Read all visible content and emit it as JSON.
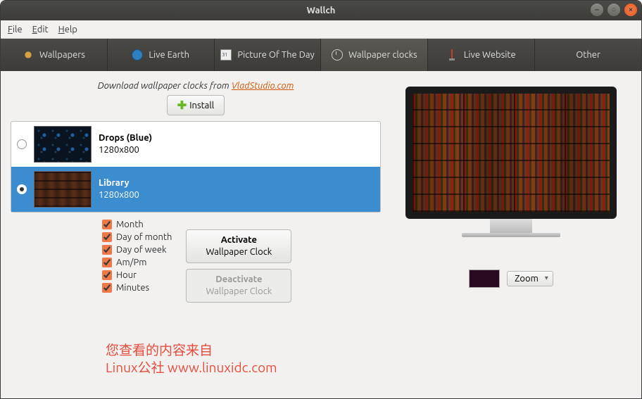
{
  "window": {
    "title": "Wallch"
  },
  "menu": {
    "file": "File",
    "edit": "Edit",
    "help": "Help"
  },
  "tabs": {
    "wallpapers": "Wallpapers",
    "liveearth": "Live Earth",
    "potd": "Picture Of The Day",
    "wallclocks": "Wallpaper clocks",
    "livewebsite": "Live Website",
    "other": "Other"
  },
  "intro": {
    "prefix": "Download wallpaper clocks from ",
    "linktext": "VladStudio.com"
  },
  "install_label": "Install",
  "clocks": [
    {
      "name": "Drops (Blue)",
      "res": "1280x800",
      "selected": false
    },
    {
      "name": "Library",
      "res": "1280x800",
      "selected": true
    }
  ],
  "checks": {
    "month": "Month",
    "dayofmonth": "Day of month",
    "dayofweek": "Day of week",
    "ampm": "Am/Pm",
    "hour": "Hour",
    "minutes": "Minutes"
  },
  "buttons": {
    "activate_l1": "Activate",
    "activate_l2": "Wallpaper Clock",
    "deactivate_l1": "Deactivate",
    "deactivate_l2": "Wallpaper Clock"
  },
  "preview": {
    "swatch_color": "#2a0a20",
    "fit_mode": "Zoom"
  },
  "watermark": {
    "line1": "您查看的内容来自",
    "line2": "Linux公社 www.linuxidc.com"
  }
}
